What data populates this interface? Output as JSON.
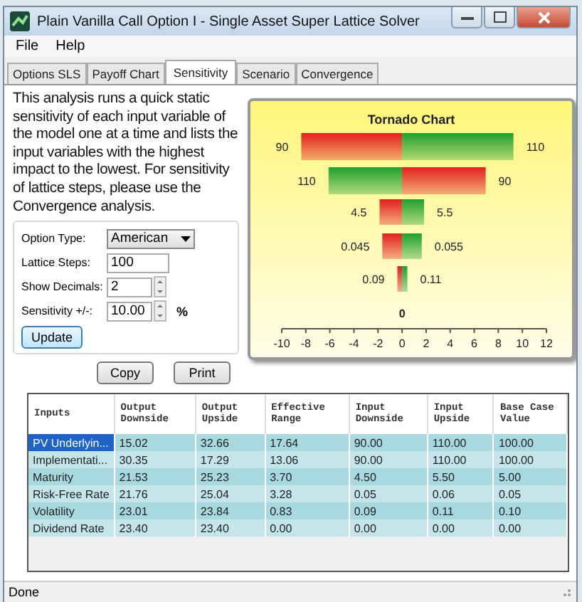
{
  "window": {
    "title": "Plain Vanilla Call Option I - Single Asset Super Lattice Solver"
  },
  "menu": [
    "File",
    "Help"
  ],
  "tabs": [
    {
      "label": "Options SLS",
      "selected": false
    },
    {
      "label": "Payoff Chart",
      "selected": false
    },
    {
      "label": "Sensitivity",
      "selected": true
    },
    {
      "label": "Scenario",
      "selected": false
    },
    {
      "label": "Convergence",
      "selected": false
    }
  ],
  "description": "This analysis runs a quick static sensitivity of each input variable of the model one at a time and lists the input variables with the highest impact to the lowest. For sensitivity of lattice steps, please use the Convergence analysis.",
  "settings": [
    {
      "kind": "dropdown",
      "label": "Option Type:",
      "value": "American"
    },
    {
      "kind": "text",
      "label": "Lattice Steps:",
      "value": "100"
    },
    {
      "kind": "spinner",
      "label": "Show Decimals:",
      "value": "2"
    },
    {
      "kind": "spinner",
      "label": "Sensitivity +/-:",
      "value": "10.00",
      "unit": "%"
    }
  ],
  "update_button": "Update",
  "buttons": [
    "Copy",
    "Print"
  ],
  "chart": {
    "title": "Tornado Chart",
    "rows": [
      {
        "downside_label": "90",
        "upside_label": "110"
      },
      {
        "downside_label": "90",
        "upside_label": "110"
      },
      {
        "downside_label": "4.5",
        "upside_label": "5.5"
      },
      {
        "downside_label": "0.045",
        "upside_label": "0.055"
      },
      {
        "downside_label": "0.09",
        "upside_label": "0.11"
      },
      {
        "center_label": "0"
      }
    ],
    "axis_ticks": [
      "-10",
      "-8",
      "-6",
      "-4",
      "-2",
      "0",
      "2",
      "4",
      "6",
      "8",
      "10",
      "12"
    ]
  },
  "table": {
    "columns": [
      "Inputs",
      "Output Downside",
      "Output Upside",
      "Effective Range",
      "Input Downside",
      "Input Upside",
      "Base Case Value"
    ],
    "rows": [
      {
        "selected": true,
        "cells": [
          "PV Underlyin...",
          "15.02",
          "32.66",
          "17.64",
          "90.00",
          "110.00",
          "100.00"
        ]
      },
      {
        "selected": false,
        "cells": [
          "Implementati...",
          "30.35",
          "17.29",
          "13.06",
          "90.00",
          "110.00",
          "100.00"
        ]
      },
      {
        "selected": false,
        "cells": [
          "Maturity",
          "21.53",
          "25.23",
          "3.70",
          "4.50",
          "5.50",
          "5.00"
        ]
      },
      {
        "selected": false,
        "cells": [
          "Risk-Free Rate",
          "21.76",
          "25.04",
          "3.28",
          "0.05",
          "0.06",
          "0.05"
        ]
      },
      {
        "selected": false,
        "cells": [
          "Volatility",
          "23.01",
          "23.84",
          "0.83",
          "0.09",
          "0.11",
          "0.10"
        ]
      },
      {
        "selected": false,
        "cells": [
          "Dividend Rate",
          "23.40",
          "23.40",
          "0.00",
          "0.00",
          "0.00",
          "0.00"
        ]
      }
    ]
  },
  "status_bar": "Done"
}
